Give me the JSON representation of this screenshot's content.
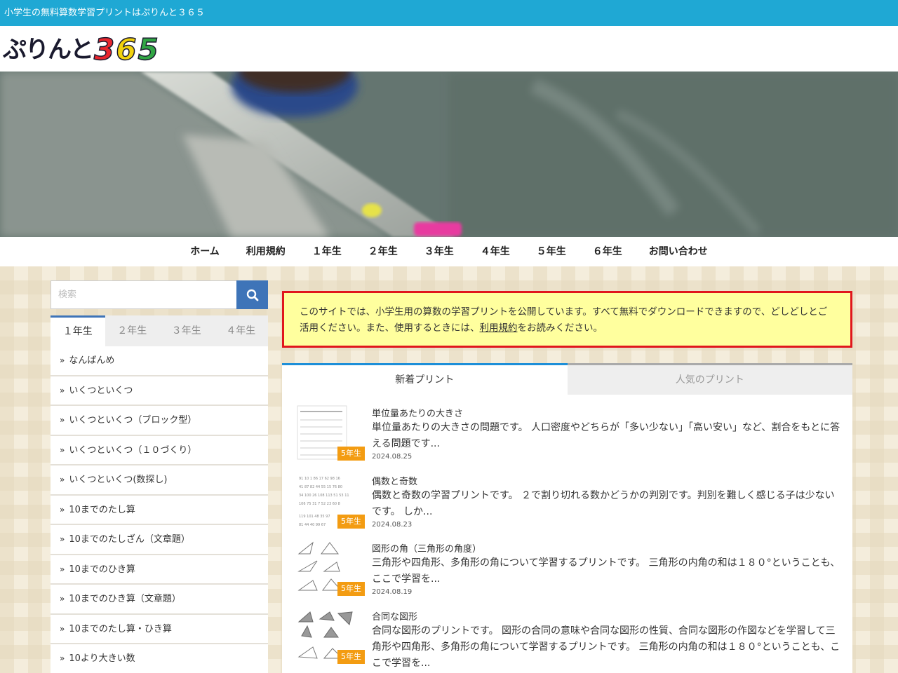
{
  "topbar": {
    "text": "小学生の無料算数学習プリントはぷりんと３６５"
  },
  "logo": {
    "kana": "ぷりんと",
    "digit1": "3",
    "digit2": "6",
    "digit3": "5"
  },
  "nav": {
    "items": [
      "ホーム",
      "利用規約",
      "１年生",
      "２年生",
      "３年生",
      "４年生",
      "５年生",
      "６年生",
      "お問い合わせ"
    ]
  },
  "search": {
    "placeholder": "検索"
  },
  "side_tabs": [
    "１年生",
    "２年生",
    "３年生",
    "４年生"
  ],
  "side_list": [
    "なんばんめ",
    "いくつといくつ",
    "いくつといくつ（ブロック型）",
    "いくつといくつ（１０づくり）",
    "いくつといくつ(数探し)",
    "10までのたし算",
    "10までのたしざん（文章題）",
    "10までのひき算",
    "10までのひき算（文章題）",
    "10までのたし算・ひき算",
    "10より大きい数"
  ],
  "notice": {
    "text1": "このサイトでは、小学生用の算数の学習プリントを公開しています。すべて無料でダウンロードできますので、どしどしとご活用ください。また、使用するときには、",
    "link": "利用規約",
    "text2": "をお読みください。"
  },
  "panel_tabs": [
    "新着プリント",
    "人気のプリント"
  ],
  "posts": [
    {
      "title": "単位量あたりの大きさ",
      "excerpt": "単位量あたりの大きさの問題です。 人口密度やどちらが「多い少ない」「高い安い」など、割合をもとに答える問題です...",
      "date": "2024.08.25",
      "badge": "5年生"
    },
    {
      "title": "偶数と奇数",
      "excerpt": "偶数と奇数の学習プリントです。 ２で割り切れる数かどうかの判別です。判別を難しく感じる子は少ないです。 しか...",
      "date": "2024.08.23",
      "badge": "5年生"
    },
    {
      "title": "図形の角（三角形の角度）",
      "excerpt": "三角形や四角形、多角形の角について学習するプリントです。 三角形の内角の和は１８０°ということも、ここで学習を...",
      "date": "2024.08.19",
      "badge": "5年生"
    },
    {
      "title": "合同な図形",
      "excerpt": "合同な図形のプリントです。 図形の合同の意味や合同な図形の性質、合同な図形の作図などを学習して三角形や四角形、多角形の角について学習するプリントです。 三角形の内角の和は１８０°ということも、ここで学習を...",
      "date": "",
      "badge": "5年生"
    }
  ],
  "colors": {
    "accent": "#1fa8d4",
    "search_btn": "#3e74b8",
    "badge": "#f39c12",
    "notice_border": "#e0161d",
    "notice_bg": "#ffff9e"
  }
}
